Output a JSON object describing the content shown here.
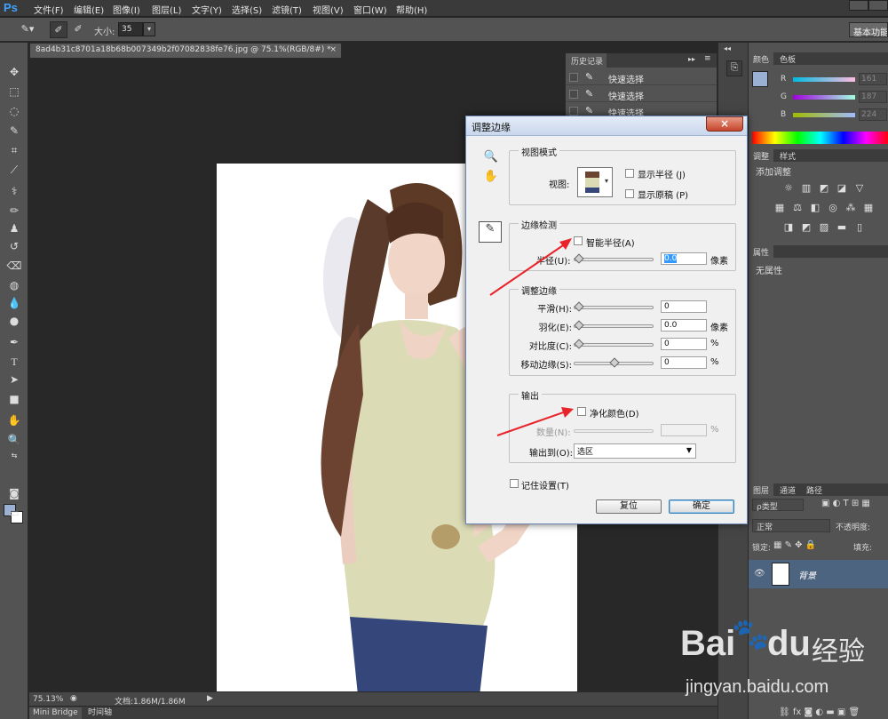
{
  "app": {
    "logo": "Ps"
  },
  "menu": [
    "文件(F)",
    "编辑(E)",
    "图像(I)",
    "图层(L)",
    "文字(Y)",
    "选择(S)",
    "滤镜(T)",
    "视图(V)",
    "窗口(W)",
    "帮助(H)"
  ],
  "options": {
    "size_label": "大小:",
    "size_value": "35",
    "workspace": "基本功能"
  },
  "document": {
    "tab_title": "8ad4b31c8701a18b68b007349b2f07082838fe76.jpg @ 75.1%(RGB/8#) *",
    "close": "×",
    "zoom": "75.13%",
    "doc_info": "文档:1.86M/1.86M"
  },
  "bottom_tabs": [
    "Mini Bridge",
    "时间轴"
  ],
  "history": {
    "title": "历史记录",
    "items": [
      "快速选择",
      "快速选择",
      "快速选择"
    ]
  },
  "color_panel": {
    "tabs": [
      "颜色",
      "色板"
    ],
    "sliders": [
      {
        "letter": "R",
        "value": "161"
      },
      {
        "letter": "G",
        "value": "187"
      },
      {
        "letter": "B",
        "value": "224"
      }
    ],
    "fg_color": "#9bb1d4"
  },
  "adjust_panel": {
    "tabs": [
      "调整",
      "样式"
    ],
    "title": "添加调整"
  },
  "props_panel": {
    "tab": "属性",
    "text": "无属性"
  },
  "layers_panel": {
    "tabs": [
      "图层",
      "通道",
      "路径"
    ],
    "kind": "ρ类型",
    "blend_mode": "正常",
    "opacity_label": "不透明度:",
    "lock_label": "锁定:",
    "fill_label": "填充:",
    "layer_name": "背景"
  },
  "dialog": {
    "title": "调整边缘",
    "close": "×",
    "view_mode": {
      "title": "视图模式",
      "view_label": "视图:",
      "show_radius": "显示半径 (J)",
      "show_original": "显示原稿 (P)"
    },
    "edge_detection": {
      "title": "边缘检测",
      "smart_radius": "智能半径(A)",
      "radius_label": "半径(U):",
      "radius_value": "0.0",
      "unit": "像素"
    },
    "adjust_edge": {
      "title": "调整边缘",
      "rows": [
        {
          "label": "平滑(H):",
          "value": "0",
          "unit": ""
        },
        {
          "label": "羽化(E):",
          "value": "0.0",
          "unit": "像素"
        },
        {
          "label": "对比度(C):",
          "value": "0",
          "unit": "%"
        },
        {
          "label": "移动边缘(S):",
          "value": "0",
          "unit": "%"
        }
      ]
    },
    "output": {
      "title": "输出",
      "decontaminate": "净化颜色(D)",
      "amount_label": "数量(N):",
      "amount_unit": "%",
      "output_to_label": "输出到(O):",
      "output_to_value": "选区"
    },
    "remember": "记住设置(T)",
    "reset": "复位",
    "ok": "确定"
  },
  "watermark": {
    "brand": "Bai",
    "brand2": "du",
    "cn": "经验",
    "url": "jingyan.baidu.com"
  }
}
